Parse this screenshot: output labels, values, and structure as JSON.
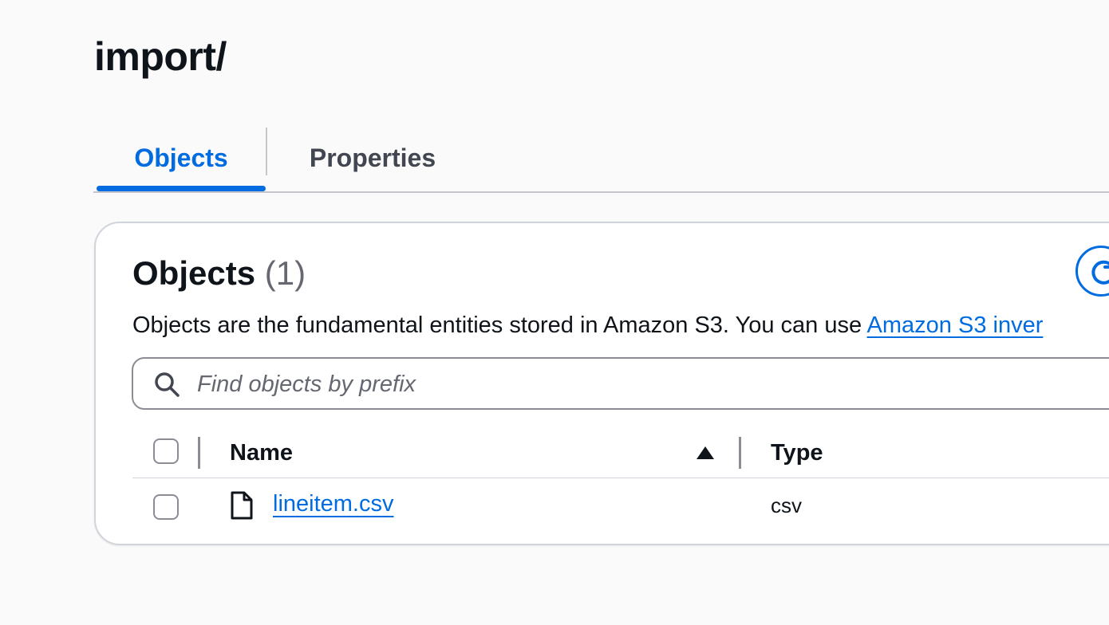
{
  "page": {
    "title": "import/"
  },
  "tabs": [
    {
      "label": "Objects",
      "active": true
    },
    {
      "label": "Properties",
      "active": false
    }
  ],
  "objects_panel": {
    "heading": "Objects",
    "count": "(1)",
    "description_prefix": "Objects are the fundamental entities stored in Amazon S3. You can use ",
    "description_link": "Amazon S3 inver",
    "refresh_icon": "refresh-icon"
  },
  "search": {
    "placeholder": "Find objects by prefix",
    "value": "",
    "icon": "search-icon"
  },
  "table": {
    "columns": [
      {
        "label": "Name",
        "sort": "ascending"
      },
      {
        "label": "Type"
      }
    ],
    "rows": [
      {
        "name": "lineitem.csv",
        "type": "csv",
        "icon": "file-icon",
        "selected": false
      }
    ]
  },
  "colors": {
    "accent": "#006ce0",
    "text": "#0f141a",
    "muted": "#656871",
    "border": "#d1d5db",
    "background": "#fafafa"
  }
}
